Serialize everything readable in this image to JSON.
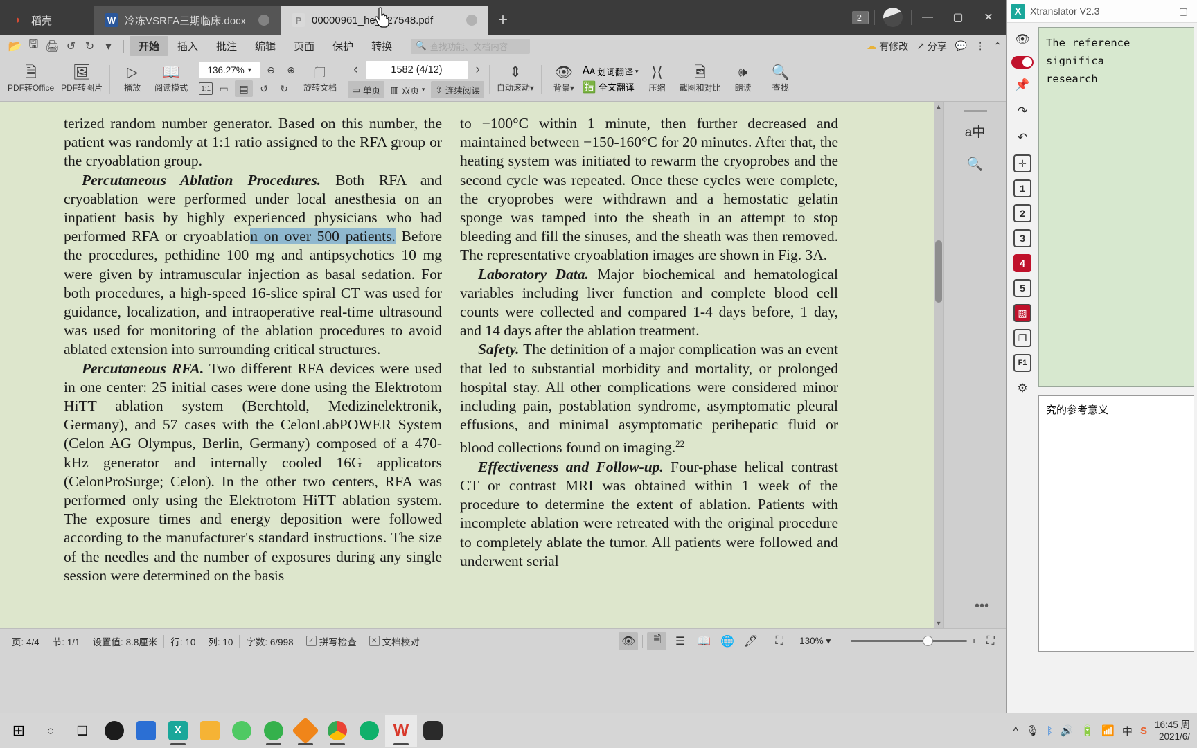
{
  "window": {
    "tabs": [
      {
        "label": "稻壳",
        "icon": "wps-docer-icon",
        "type": "home"
      },
      {
        "label": "冷冻VSRFA三期临床.docx",
        "icon": "word-doc-icon",
        "type": "doc"
      },
      {
        "label": "00000961_he__27548.pdf",
        "icon": "pdf-doc-icon",
        "type": "pdf",
        "active": true
      }
    ],
    "new_tab_label": "+",
    "doc_count_badge": "2",
    "minimize_label": "—",
    "maximize_label": "▢",
    "close_label": "✕"
  },
  "quick_access": {
    "open_label": "📂",
    "save_label": "🖫",
    "print_label": "🖨",
    "undo_label": "↺",
    "redo_label": "↻",
    "more_label": "▾"
  },
  "menu": {
    "items": [
      "开始",
      "插入",
      "批注",
      "编辑",
      "页面",
      "保护",
      "转换"
    ],
    "active": "开始",
    "search_placeholder": "查找功能、文档内容",
    "modified_label": "有修改",
    "share_label": "分享",
    "comment_label": "💬",
    "more_label": "⋮",
    "collapse_label": "⌃"
  },
  "ribbon": {
    "pdf_to_office": "PDF转Office",
    "pdf_to_image": "PDF转图片",
    "play": "播放",
    "read_mode": "阅读模式",
    "zoom_value": "136.27%",
    "zoom_out": "−",
    "zoom_in": "+",
    "fit_actual": "1:1",
    "fit_page": "▭",
    "fit_width": "▤",
    "rotate_ccw": "↺",
    "rotate_cw": "↻",
    "rotate_doc": "旋转文档",
    "single_page": "单页",
    "double_page": "双页",
    "continuous": "连续阅读",
    "auto_scroll": "自动滚动",
    "background": "背景",
    "word_translate": "划词翻译",
    "full_translate": "全文翻译",
    "compress": "压缩",
    "screenshot_compare": "截图和对比",
    "read_aloud": "朗读",
    "find": "查找"
  },
  "page_nav": {
    "prev_label": "‹",
    "next_label": "›",
    "page_display": "1582 (4/12)"
  },
  "document": {
    "left_column": [
      {
        "text": "terized random number generator. Based on this number, the patient was randomly at 1:1 ratio assigned to the RFA group or the cryoablation group."
      },
      {
        "heading": "Percutaneous Ablation Procedures.",
        "text": " Both RFA and cryoablation were performed under local anesthesia on an inpatient basis by highly experienced physicians who had performed RFA or cryoablatio",
        "selected": "n on over 500 patients.",
        "text_after": " Before the procedures, pethidine 100 mg and antipsychotics 10 mg were given by intramuscular injection as basal sedation. For both procedures, a high-speed 16-slice spiral CT was used for guidance, localization, and intraoperative real-time ultrasound was used for monitoring of the ablation procedures to avoid ablated extension into surrounding critical structures."
      },
      {
        "heading": "Percutaneous RFA.",
        "text": " Two different RFA devices were used in one center: 25 initial cases were done using the Elektrotom HiTT ablation system (Berchtold, Medizinelektronik, Germany), and 57 cases with the CelonLabPOWER System (Celon AG Olympus, Berlin, Germany) composed of a 470-kHz generator and internally cooled 16G applicators (CelonProSurge; Celon). In the other two centers, RFA was performed only using the Elektrotom HiTT ablation system. The exposure times and energy deposition were followed according to the manufacturer's standard instructions. The size of the needles and the number of exposures during any single session were determined on the basis"
      }
    ],
    "right_column": [
      {
        "text": "to −100°C within 1 minute, then further decreased and maintained between −150-160°C for 20 minutes. After that, the heating system was initiated to rewarm the cryoprobes and the second cycle was repeated. Once these cycles were complete, the cryoprobes were withdrawn and a hemostatic gelatin sponge was tamped into the sheath in an attempt to stop bleeding and fill the sinuses, and the sheath was then removed. The representative cryoablation images are shown in Fig. 3A."
      },
      {
        "heading": "Laboratory Data.",
        "text": " Major biochemical and hematological variables including liver function and complete blood cell counts were collected and compared 1-4 days before, 1 day, and 14 days after the ablation treatment."
      },
      {
        "heading": "Safety.",
        "text": " The definition of a major complication was an event that led to substantial morbidity and mortality, or prolonged hospital stay. All other complications were considered minor including pain, postablation syndrome, asymptomatic pleural effusions, and minimal asymptomatic perihepatic fluid or blood collections found on imaging.",
        "superscript": "22"
      },
      {
        "heading": "Effectiveness and Follow-up.",
        "text": " Four-phase helical contrast CT or contrast MRI was obtained within 1 week of the procedure to determine the extent of ablation. Patients with incomplete ablation were retreated with the original procedure to completely ablate the tumor. All patients were followed and underwent serial"
      }
    ]
  },
  "doc_rail": {
    "translate_label": "a中",
    "find_label": "🔍"
  },
  "statusbar": {
    "page": "页: 4/4",
    "section": "节: 1/1",
    "setting": "设置值: 8.8厘米",
    "row": "行: 10",
    "col": "列: 10",
    "words": "字数: 6/998",
    "spellcheck": "拼写检查",
    "proofread": "文档校对",
    "eye_protect": "护眼模式",
    "view_page": "页面视图",
    "view_outline": "大纲视图",
    "view_read": "阅读版式",
    "view_web": "Web版式",
    "view_mark": "标注",
    "fit_label": "适应",
    "zoom_value": "130%",
    "zoom_out": "−",
    "zoom_in": "+",
    "fullscreen": "⛶"
  },
  "xtranslator": {
    "title": "Xtranslator V2.3",
    "minimize": "—",
    "maximize": "▢",
    "rail": [
      {
        "name": "eye-off-icon",
        "label": "👁"
      },
      {
        "name": "power-toggle",
        "label": ""
      },
      {
        "name": "pin-icon",
        "label": "📌"
      },
      {
        "name": "redo-icon",
        "label": "↷"
      },
      {
        "name": "undo-icon",
        "label": "↶"
      },
      {
        "name": "plus-icon",
        "label": "✛"
      },
      {
        "name": "preset-1",
        "label": "1"
      },
      {
        "name": "preset-2",
        "label": "2"
      },
      {
        "name": "preset-3",
        "label": "3"
      },
      {
        "name": "preset-4",
        "label": "4",
        "active": true
      },
      {
        "name": "preset-5",
        "label": "5"
      },
      {
        "name": "select-area-icon",
        "label": "▧"
      },
      {
        "name": "copy-icon",
        "label": "❐"
      },
      {
        "name": "help-icon",
        "label": "F1"
      },
      {
        "name": "settings-gear-icon",
        "label": "⚙"
      }
    ],
    "output_text": "The reference significa\nresearch",
    "input_text": "究的参考意义"
  },
  "taskbar": {
    "start_label": "⊞",
    "search_label": "○",
    "taskview_label": "❐",
    "apps": [
      {
        "name": "app-beats",
        "color": "#1c1c1c"
      },
      {
        "name": "app-scanner",
        "color": "#2b6fd4"
      },
      {
        "name": "app-xtranslator",
        "color": "#1aa79a",
        "running": true
      },
      {
        "name": "app-file-explorer",
        "color": "#f5b335"
      },
      {
        "name": "app-wechat",
        "color": "#4fc963",
        "running": true
      },
      {
        "name": "app-evernote",
        "color": "#35b14c",
        "running": true
      },
      {
        "name": "app-sogou",
        "color": "#f08519",
        "running": true
      },
      {
        "name": "app-chrome",
        "color": "#4285f4",
        "running": true
      },
      {
        "name": "app-360",
        "color": "#0fb06b"
      },
      {
        "name": "app-wps",
        "color": "#d8392b",
        "active": true
      },
      {
        "name": "app-recorder",
        "color": "#2a2a2a"
      }
    ],
    "tray": {
      "chevron": "^",
      "mic": "🎤",
      "bluetooth": "ᛒ",
      "volume": "🔊",
      "battery": "🔋",
      "wifi": "📶",
      "ime": "中",
      "sogou": "S",
      "time": "16:45 周",
      "date": "2021/6/"
    }
  }
}
